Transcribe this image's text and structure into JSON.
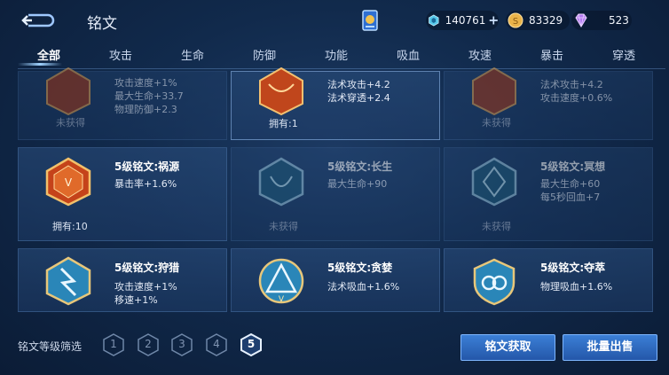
{
  "header": {
    "title": "铭文",
    "currency": [
      {
        "name": "gem",
        "value": "140761"
      },
      {
        "name": "gold",
        "value": "83329"
      },
      {
        "name": "diamond",
        "value": "523"
      }
    ]
  },
  "tabs": [
    "全部",
    "攻击",
    "生命",
    "防御",
    "功能",
    "吸血",
    "攻速",
    "暴击",
    "穿透"
  ],
  "active_tab": 0,
  "cards": [
    {
      "name": "",
      "stats": [
        "攻击速度+1%",
        "最大生命+33.7",
        "物理防御+2.3"
      ],
      "status": "未获得"
    },
    {
      "name": "",
      "stats": [
        "法术攻击+4.2",
        "法术穿透+2.4"
      ],
      "status": "拥有:1"
    },
    {
      "name": "",
      "stats": [
        "法术攻击+4.2",
        "攻击速度+0.6%"
      ],
      "status": "未获得"
    },
    {
      "name": "5级铭文:祸源",
      "stats": [
        "暴击率+1.6%"
      ],
      "status": "拥有:10"
    },
    {
      "name": "5级铭文:长生",
      "stats": [
        "最大生命+90"
      ],
      "status": "未获得"
    },
    {
      "name": "5级铭文:冥想",
      "stats": [
        "最大生命+60",
        "每5秒回血+7"
      ],
      "status": "未获得"
    },
    {
      "name": "5级铭文:狩猎",
      "stats": [
        "攻击速度+1%",
        "移速+1%"
      ],
      "status": ""
    },
    {
      "name": "5级铭文:贪婪",
      "stats": [
        "法术吸血+1.6%"
      ],
      "status": ""
    },
    {
      "name": "5级铭文:夺萃",
      "stats": [
        "物理吸血+1.6%"
      ],
      "status": ""
    }
  ],
  "footer": {
    "filter_label": "铭文等级筛选",
    "levels": [
      "1",
      "2",
      "3",
      "4",
      "5"
    ],
    "selected_level": "5",
    "get_button": "铭文获取",
    "sell_button": "批量出售"
  }
}
